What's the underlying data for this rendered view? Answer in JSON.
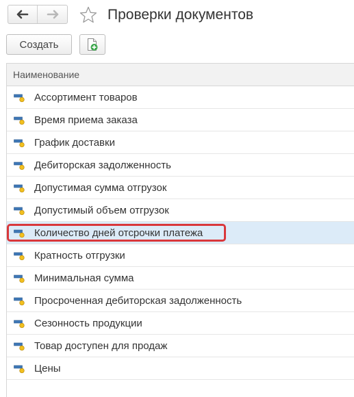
{
  "header": {
    "title": "Проверки документов",
    "back_icon": "arrow-left-icon",
    "forward_icon": "arrow-right-icon",
    "favorite_icon": "star-icon"
  },
  "toolbar": {
    "create_label": "Создать",
    "add_icon": "add-document-icon"
  },
  "table": {
    "column_header": "Наименование",
    "row_icon": "catalog-item-icon",
    "selected_index": 6,
    "rows": [
      "Ассортимент товаров",
      "Время приема заказа",
      "График доставки",
      "Дебиторская задолженность",
      "Допустимая сумма отгрузок",
      "Допустимый объем отгрузок",
      "Количество дней отсрочки платежа",
      "Кратность отгрузки",
      "Минимальная сумма",
      "Просроченная дебиторская задолженность",
      "Сезонность продукции",
      "Товар доступен для продаж",
      "Цены"
    ]
  },
  "colors": {
    "selected_row": "#dcebf8",
    "highlight_border": "#d9373b",
    "icon_blue": "#3f78b7",
    "icon_yellow": "#f2c01f"
  }
}
